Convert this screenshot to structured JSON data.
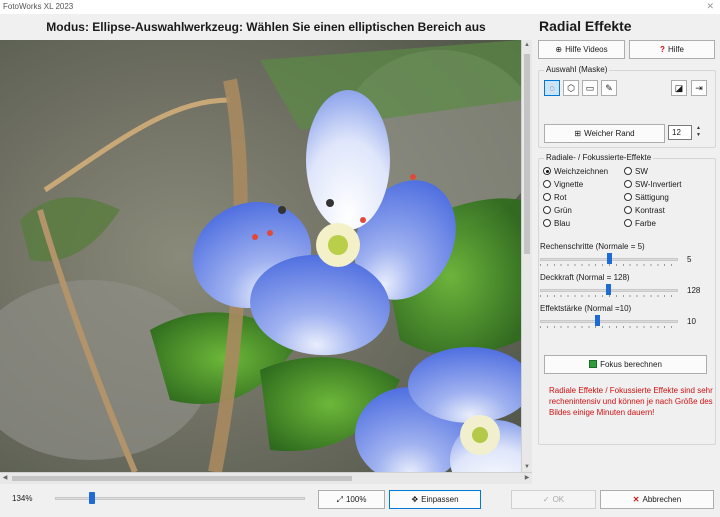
{
  "window": {
    "title": "FotoWorks XL 2023",
    "close_glyph": "✕"
  },
  "mode_title": "Modus: Ellipse-Auswahlwerkzeug: Wählen Sie einen elliptischen Bereich aus",
  "panel": {
    "title": "Radial Effekte",
    "help_videos": "Hilfe Videos",
    "help": "Hilfe",
    "selection_group": "Auswahl (Maske)",
    "tools": [
      {
        "name": "ellipse-select-icon",
        "glyph": "◌",
        "selected": true
      },
      {
        "name": "lasso-select-icon",
        "glyph": "⬡",
        "selected": false
      },
      {
        "name": "rectangle-select-icon",
        "glyph": "▭",
        "selected": false
      },
      {
        "name": "magic-wand-icon",
        "glyph": "✎",
        "selected": false
      }
    ],
    "invert_icon": "◪",
    "export_icon": "⇥",
    "soft_edge_label": "Weicher Rand",
    "soft_edge_value": "12",
    "effects_group": "Radiale- / Fokussierte-Effekte",
    "effects_left": [
      "Weichzeichnen",
      "Vignette",
      "Rot",
      "Grün",
      "Blau"
    ],
    "effects_right": [
      "SW",
      "SW-Invertiert",
      "Sättigung",
      "Kontrast",
      "Farbe"
    ],
    "selected_effect": "Weichzeichnen",
    "sliders": [
      {
        "label": "Rechenschritte (Normale = 5)",
        "value": "5",
        "level": 0.5
      },
      {
        "label": "Deckkraft (Normal = 128)",
        "value": "128",
        "level": 0.49
      },
      {
        "label": "Effektstärke (Normal =10)",
        "value": "10",
        "level": 0.41
      }
    ],
    "compute_focus": "Fokus berechnen",
    "warning": "Radiale Effekte / Fokussierte Effekte sind sehr rechenintensiv und können je nach Größe des Bildes einige Minuten dauern!"
  },
  "bottom": {
    "zoom_label": "134%",
    "zoom_level": 0.14,
    "btn_100": "100%",
    "btn_fit": "Einpassen",
    "btn_ok": "OK",
    "btn_cancel": "Abbrechen"
  },
  "colors": {
    "accent": "#1e6bd6",
    "warning": "#d01010",
    "ok_green": "#2e9e3a",
    "cancel_red": "#c41e1e"
  }
}
